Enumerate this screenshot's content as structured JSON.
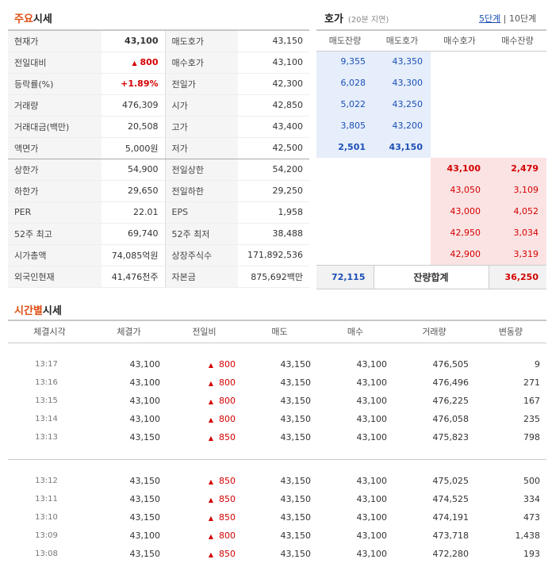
{
  "main": {
    "title_hl": "주요",
    "title_rest": "시세",
    "rows": [
      {
        "l1": "현재가",
        "v1": "43,100",
        "l2": "매도호가",
        "v2": "43,150"
      },
      {
        "l1": "전일대비",
        "v1": "800",
        "l2": "매수호가",
        "v2": "43,100"
      },
      {
        "l1": "등락률(%)",
        "v1": "+1.89%",
        "l2": "전일가",
        "v2": "42,300"
      },
      {
        "l1": "거래량",
        "v1": "476,309",
        "l2": "시가",
        "v2": "42,850"
      },
      {
        "l1": "거래대금(백만)",
        "v1": "20,508",
        "l2": "고가",
        "v2": "43,400"
      },
      {
        "l1": "액면가",
        "v1": "5,000원",
        "l2": "저가",
        "v2": "42,500"
      },
      {
        "l1": "상한가",
        "v1": "54,900",
        "l2": "전일상한",
        "v2": "54,200"
      },
      {
        "l1": "하한가",
        "v1": "29,650",
        "l2": "전일하한",
        "v2": "29,250"
      },
      {
        "l1": "PER",
        "v1": "22.01",
        "l2": "EPS",
        "v2": "1,958"
      },
      {
        "l1": "52주 최고",
        "v1": "69,740",
        "l2": "52주 최저",
        "v2": "38,488"
      },
      {
        "l1": "시가총액",
        "v1": "74,085억원",
        "l2": "상장주식수",
        "v2": "171,892,536"
      },
      {
        "l1": "외국인현재",
        "v1": "41,476천주",
        "l2": "자본금",
        "v2": "875,692백만"
      }
    ]
  },
  "hoga": {
    "title": "호가",
    "delay": "(20분 지연)",
    "tab5": "5단계",
    "tab10": "10단계",
    "sep": "|",
    "headers": [
      "매도잔량",
      "매도호가",
      "매수호가",
      "매수잔량"
    ],
    "asks": [
      {
        "qty": "9,355",
        "price": "43,350"
      },
      {
        "qty": "6,028",
        "price": "43,300"
      },
      {
        "qty": "5,022",
        "price": "43,250"
      },
      {
        "qty": "3,805",
        "price": "43,200"
      },
      {
        "qty": "2,501",
        "price": "43,150"
      }
    ],
    "bids": [
      {
        "price": "43,100",
        "qty": "2,479"
      },
      {
        "price": "43,050",
        "qty": "3,109"
      },
      {
        "price": "43,000",
        "qty": "4,052"
      },
      {
        "price": "42,950",
        "qty": "3,034"
      },
      {
        "price": "42,900",
        "qty": "3,319"
      }
    ],
    "total_ask": "72,115",
    "total_label": "잔량합계",
    "total_bid": "36,250"
  },
  "ticks": {
    "title_hl": "시간별",
    "title_rest": "시세",
    "headers": [
      "체결시각",
      "체결가",
      "전일비",
      "매도",
      "매수",
      "거래량",
      "변동량"
    ],
    "rows": [
      {
        "time": "13:17",
        "price": "43,100",
        "diff": "800",
        "ask": "43,150",
        "bid": "43,100",
        "vol": "476,505",
        "chg": "9"
      },
      {
        "time": "13:16",
        "price": "43,100",
        "diff": "800",
        "ask": "43,150",
        "bid": "43,100",
        "vol": "476,496",
        "chg": "271"
      },
      {
        "time": "13:15",
        "price": "43,100",
        "diff": "800",
        "ask": "43,150",
        "bid": "43,100",
        "vol": "476,225",
        "chg": "167"
      },
      {
        "time": "13:14",
        "price": "43,100",
        "diff": "800",
        "ask": "43,150",
        "bid": "43,100",
        "vol": "476,058",
        "chg": "235"
      },
      {
        "time": "13:13",
        "price": "43,150",
        "diff": "850",
        "ask": "43,150",
        "bid": "43,100",
        "vol": "475,823",
        "chg": "798"
      },
      {
        "time": "13:12",
        "price": "43,150",
        "diff": "850",
        "ask": "43,150",
        "bid": "43,100",
        "vol": "475,025",
        "chg": "500"
      },
      {
        "time": "13:11",
        "price": "43,150",
        "diff": "850",
        "ask": "43,150",
        "bid": "43,100",
        "vol": "474,525",
        "chg": "334"
      },
      {
        "time": "13:10",
        "price": "43,150",
        "diff": "850",
        "ask": "43,150",
        "bid": "43,100",
        "vol": "474,191",
        "chg": "473"
      },
      {
        "time": "13:09",
        "price": "43,100",
        "diff": "800",
        "ask": "43,150",
        "bid": "43,100",
        "vol": "473,718",
        "chg": "1,438"
      },
      {
        "time": "13:08",
        "price": "43,150",
        "diff": "850",
        "ask": "43,150",
        "bid": "43,100",
        "vol": "472,280",
        "chg": "193"
      }
    ]
  },
  "up_symbol": "▲",
  "colors": {
    "up": "#d40000",
    "ask_bg": "#e6eefb",
    "bid_bg": "#fbe3e3",
    "accent": "#dd4c11",
    "blue": "#1b4fb6"
  }
}
